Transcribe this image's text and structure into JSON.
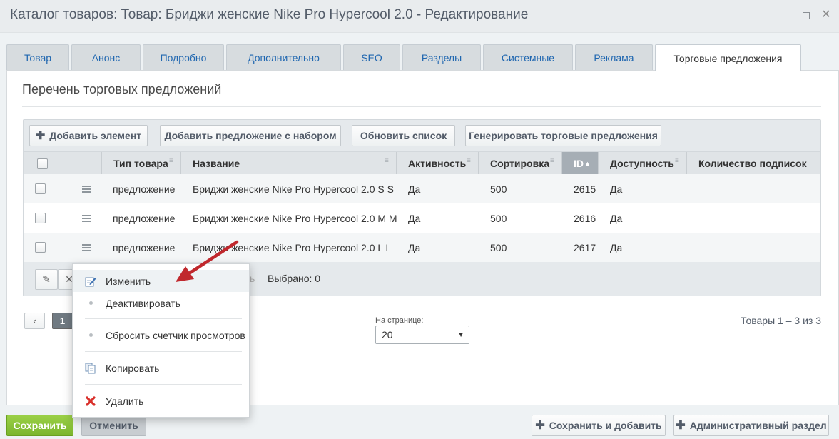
{
  "window": {
    "title": "Каталог товаров: Товар: Бриджи женские Nike Pro Hypercool 2.0 - Редактирование"
  },
  "tabs": [
    {
      "label": "Товар"
    },
    {
      "label": "Анонс"
    },
    {
      "label": "Подробно"
    },
    {
      "label": "Дополнительно"
    },
    {
      "label": "SEO"
    },
    {
      "label": "Разделы"
    },
    {
      "label": "Системные"
    },
    {
      "label": "Реклама"
    },
    {
      "label": "Торговые предложения"
    }
  ],
  "section": {
    "title": "Перечень торговых предложений"
  },
  "toolbar": {
    "add_element": "Добавить элемент",
    "add_with_set": "Добавить предложение с набором",
    "refresh": "Обновить список",
    "generate": "Генерировать торговые предложения"
  },
  "table": {
    "columns": [
      "Тип товара",
      "Название",
      "Активность",
      "Сортировка",
      "ID",
      "Доступность",
      "Количество подписок"
    ],
    "rows": [
      {
        "type": "предложение",
        "name": "Бриджи женские Nike Pro Hypercool 2.0 S S",
        "active": "Да",
        "sort": "500",
        "id": "2615",
        "available": "Да",
        "subs": ""
      },
      {
        "type": "предложение",
        "name": "Бриджи женские Nike Pro Hypercool 2.0 M M",
        "active": "Да",
        "sort": "500",
        "id": "2616",
        "available": "Да",
        "subs": ""
      },
      {
        "type": "предложение",
        "name": "Бриджи женские Nike Pro Hypercool 2.0 L L",
        "active": "Да",
        "sort": "500",
        "id": "2617",
        "available": "Да",
        "subs": ""
      }
    ],
    "selected_label": "Выбрано: 0",
    "hidden_partial": "ь"
  },
  "context_menu": {
    "items": [
      {
        "label": "Изменить",
        "icon": "edit-icon"
      },
      {
        "label": "Деактивировать",
        "icon": "dot-icon"
      },
      {
        "label": "Сбросить счетчик просмотров",
        "icon": "dot-icon"
      },
      {
        "label": "Копировать",
        "icon": "copy-icon"
      },
      {
        "label": "Удалить",
        "icon": "delete-icon"
      }
    ]
  },
  "pager": {
    "prev": "‹",
    "current": "1",
    "per_page_label": "На странице:",
    "per_page_value": "20",
    "counter": "Товары 1 – 3 из 3"
  },
  "footer": {
    "save": "Сохранить",
    "cancel": "Отменить",
    "save_add": "Сохранить и добавить",
    "admin_section": "Административный раздел"
  },
  "colors": {
    "save_green": "#8cc63f",
    "accent_blue": "#2067b0",
    "arrow_red": "#c0282d"
  }
}
